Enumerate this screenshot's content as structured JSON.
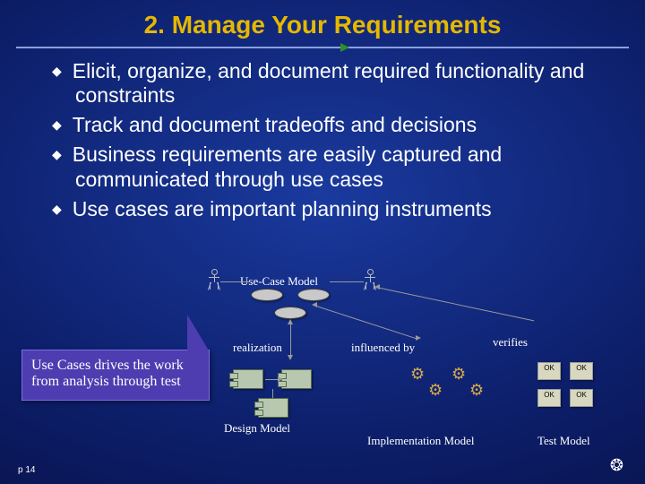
{
  "title": "2. Manage Your Requirements",
  "bullets": [
    "Elicit, organize, and document required functionality and constraints",
    "Track and document tradeoffs and decisions",
    "Business requirements are easily captured and communicated through use cases",
    "Use cases are important planning instruments"
  ],
  "callout": "Use Cases drives the work from analysis through test",
  "diagram": {
    "use_case_model": "Use-Case Model",
    "realization": "realization",
    "influenced_by": "influenced by",
    "verifies": "verifies",
    "design_model": "Design Model",
    "implementation_model": "Implementation Model",
    "test_model": "Test Model",
    "ok_badge": "OK"
  },
  "page_number": "p 14",
  "logo_glyph": "❂"
}
